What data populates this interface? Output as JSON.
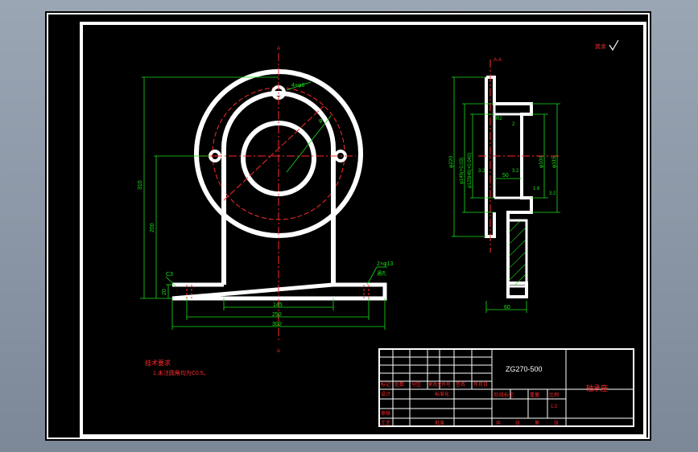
{
  "drawing": {
    "front_view": {
      "section_mark_top": "A",
      "section_mark_bottom": "A",
      "dims": {
        "overall_height": "310",
        "center_height": "200",
        "base_thickness": "20",
        "inner_width": "145",
        "hole_spacing": "250",
        "base_width": "300",
        "chamfer": "C3",
        "hole_note": "2×φ13",
        "hole_note_2": "通孔",
        "top_hole": "4×φ8",
        "bolt_circle": "φ",
        "ring_dia": "φ"
      }
    },
    "section_view": {
      "title": "A-A",
      "dims": {
        "d1": "φ220",
        "d2": "φ145(+0.03)",
        "d3": "φ125H6(+0.040)",
        "d4": "φ100",
        "d5": "φ115",
        "w1": "50",
        "w2": "60",
        "r1": "2",
        "r2": "R2",
        "s1": "3.2",
        "s2": "3.2",
        "s3": "1.6",
        "s4": "3.2"
      }
    },
    "notes": {
      "title": "技术要求",
      "line1": "1.未注圆角均为C0.5。"
    },
    "surface_mark": "其余"
  },
  "title_block": {
    "drawing_no": "ZG270-500",
    "part_name": "轴承座",
    "row_labels": [
      "标记",
      "设计",
      "审核",
      "工艺"
    ],
    "header_cells": [
      "处数",
      "分区",
      "更改文件号",
      "签名",
      "年月日"
    ],
    "standard": "标准化",
    "approve": "批准",
    "stage": "阶段标记",
    "weight": "重量",
    "scale_label": "比例",
    "scale_value": "1:2",
    "sheets": [
      "共",
      "张",
      "第",
      "张"
    ]
  }
}
